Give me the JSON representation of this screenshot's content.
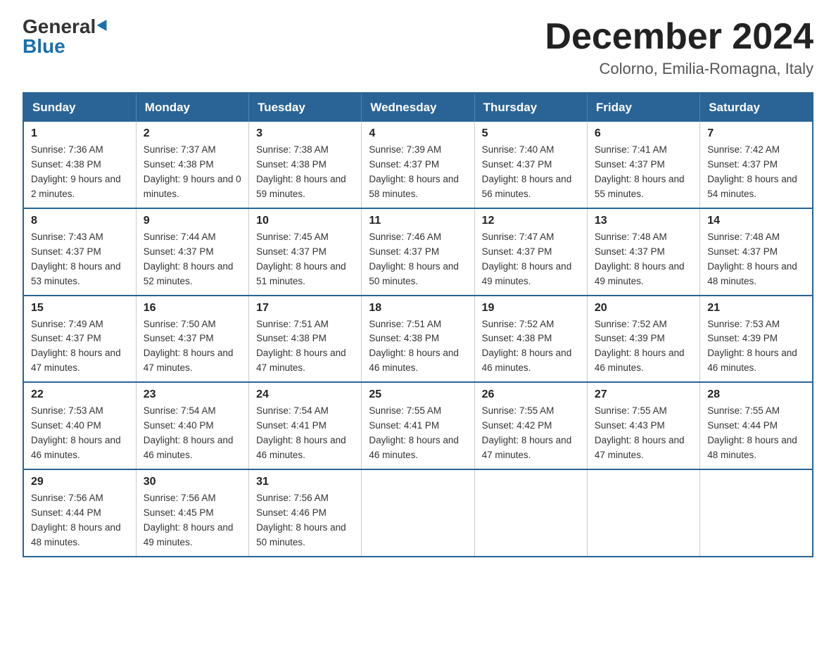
{
  "logo": {
    "general": "General",
    "blue": "Blue"
  },
  "header": {
    "month": "December 2024",
    "location": "Colorno, Emilia-Romagna, Italy"
  },
  "weekdays": [
    "Sunday",
    "Monday",
    "Tuesday",
    "Wednesday",
    "Thursday",
    "Friday",
    "Saturday"
  ],
  "weeks": [
    [
      {
        "day": 1,
        "sunrise": "7:36 AM",
        "sunset": "4:38 PM",
        "daylight": "9 hours and 2 minutes."
      },
      {
        "day": 2,
        "sunrise": "7:37 AM",
        "sunset": "4:38 PM",
        "daylight": "9 hours and 0 minutes."
      },
      {
        "day": 3,
        "sunrise": "7:38 AM",
        "sunset": "4:38 PM",
        "daylight": "8 hours and 59 minutes."
      },
      {
        "day": 4,
        "sunrise": "7:39 AM",
        "sunset": "4:37 PM",
        "daylight": "8 hours and 58 minutes."
      },
      {
        "day": 5,
        "sunrise": "7:40 AM",
        "sunset": "4:37 PM",
        "daylight": "8 hours and 56 minutes."
      },
      {
        "day": 6,
        "sunrise": "7:41 AM",
        "sunset": "4:37 PM",
        "daylight": "8 hours and 55 minutes."
      },
      {
        "day": 7,
        "sunrise": "7:42 AM",
        "sunset": "4:37 PM",
        "daylight": "8 hours and 54 minutes."
      }
    ],
    [
      {
        "day": 8,
        "sunrise": "7:43 AM",
        "sunset": "4:37 PM",
        "daylight": "8 hours and 53 minutes."
      },
      {
        "day": 9,
        "sunrise": "7:44 AM",
        "sunset": "4:37 PM",
        "daylight": "8 hours and 52 minutes."
      },
      {
        "day": 10,
        "sunrise": "7:45 AM",
        "sunset": "4:37 PM",
        "daylight": "8 hours and 51 minutes."
      },
      {
        "day": 11,
        "sunrise": "7:46 AM",
        "sunset": "4:37 PM",
        "daylight": "8 hours and 50 minutes."
      },
      {
        "day": 12,
        "sunrise": "7:47 AM",
        "sunset": "4:37 PM",
        "daylight": "8 hours and 49 minutes."
      },
      {
        "day": 13,
        "sunrise": "7:48 AM",
        "sunset": "4:37 PM",
        "daylight": "8 hours and 49 minutes."
      },
      {
        "day": 14,
        "sunrise": "7:48 AM",
        "sunset": "4:37 PM",
        "daylight": "8 hours and 48 minutes."
      }
    ],
    [
      {
        "day": 15,
        "sunrise": "7:49 AM",
        "sunset": "4:37 PM",
        "daylight": "8 hours and 47 minutes."
      },
      {
        "day": 16,
        "sunrise": "7:50 AM",
        "sunset": "4:37 PM",
        "daylight": "8 hours and 47 minutes."
      },
      {
        "day": 17,
        "sunrise": "7:51 AM",
        "sunset": "4:38 PM",
        "daylight": "8 hours and 47 minutes."
      },
      {
        "day": 18,
        "sunrise": "7:51 AM",
        "sunset": "4:38 PM",
        "daylight": "8 hours and 46 minutes."
      },
      {
        "day": 19,
        "sunrise": "7:52 AM",
        "sunset": "4:38 PM",
        "daylight": "8 hours and 46 minutes."
      },
      {
        "day": 20,
        "sunrise": "7:52 AM",
        "sunset": "4:39 PM",
        "daylight": "8 hours and 46 minutes."
      },
      {
        "day": 21,
        "sunrise": "7:53 AM",
        "sunset": "4:39 PM",
        "daylight": "8 hours and 46 minutes."
      }
    ],
    [
      {
        "day": 22,
        "sunrise": "7:53 AM",
        "sunset": "4:40 PM",
        "daylight": "8 hours and 46 minutes."
      },
      {
        "day": 23,
        "sunrise": "7:54 AM",
        "sunset": "4:40 PM",
        "daylight": "8 hours and 46 minutes."
      },
      {
        "day": 24,
        "sunrise": "7:54 AM",
        "sunset": "4:41 PM",
        "daylight": "8 hours and 46 minutes."
      },
      {
        "day": 25,
        "sunrise": "7:55 AM",
        "sunset": "4:41 PM",
        "daylight": "8 hours and 46 minutes."
      },
      {
        "day": 26,
        "sunrise": "7:55 AM",
        "sunset": "4:42 PM",
        "daylight": "8 hours and 47 minutes."
      },
      {
        "day": 27,
        "sunrise": "7:55 AM",
        "sunset": "4:43 PM",
        "daylight": "8 hours and 47 minutes."
      },
      {
        "day": 28,
        "sunrise": "7:55 AM",
        "sunset": "4:44 PM",
        "daylight": "8 hours and 48 minutes."
      }
    ],
    [
      {
        "day": 29,
        "sunrise": "7:56 AM",
        "sunset": "4:44 PM",
        "daylight": "8 hours and 48 minutes."
      },
      {
        "day": 30,
        "sunrise": "7:56 AM",
        "sunset": "4:45 PM",
        "daylight": "8 hours and 49 minutes."
      },
      {
        "day": 31,
        "sunrise": "7:56 AM",
        "sunset": "4:46 PM",
        "daylight": "8 hours and 50 minutes."
      },
      null,
      null,
      null,
      null
    ]
  ]
}
